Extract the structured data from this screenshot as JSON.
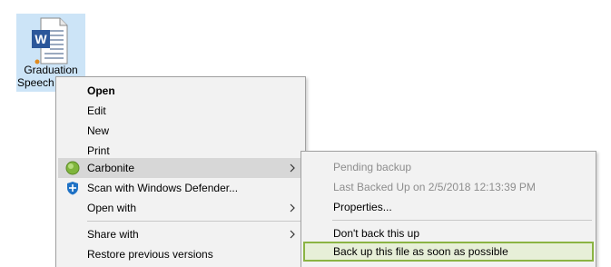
{
  "desktop": {
    "file": {
      "name_line1": "Graduation",
      "name_line2": "Speech",
      "icon": "word-document-icon",
      "accent_color": "#2b579a"
    }
  },
  "context_menu": {
    "items": [
      {
        "label": "Open",
        "bold": true
      },
      {
        "label": "Edit"
      },
      {
        "label": "New"
      },
      {
        "label": "Print"
      },
      {
        "label": "Carbonite",
        "icon": "carbonite-icon",
        "submenu": true,
        "hovered": true
      },
      {
        "label": "Scan with Windows Defender...",
        "icon": "windows-defender-icon"
      },
      {
        "label": "Open with",
        "submenu": true
      },
      {
        "label": "Share with",
        "submenu": true
      },
      {
        "label": "Restore previous versions"
      }
    ]
  },
  "carbonite_submenu": {
    "items": [
      {
        "label": "Pending backup",
        "disabled": true
      },
      {
        "label": "Last Backed Up on 2/5/2018 12:13:39 PM",
        "disabled": true
      },
      {
        "label": "Properties..."
      },
      {
        "label": "Don't back this up"
      },
      {
        "label": "Back up this file as soon as possible",
        "highlighted": true
      }
    ],
    "highlight_color": "#8bb443"
  }
}
